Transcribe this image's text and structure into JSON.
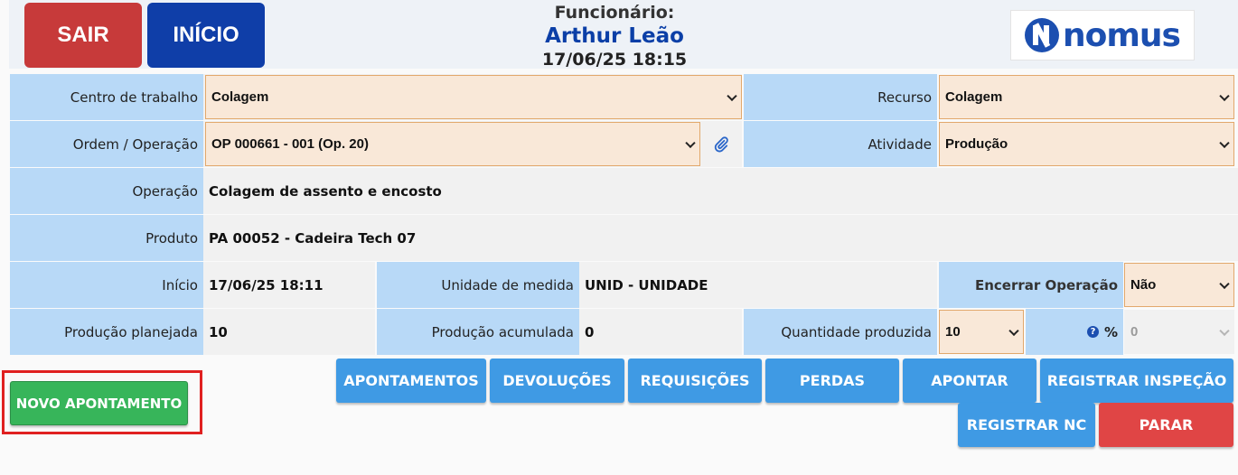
{
  "header": {
    "sair_label": "SAIR",
    "inicio_label": "INÍCIO",
    "employee_label": "Funcionário:",
    "employee_name": "Arthur Leão",
    "datetime": "17/06/25 18:15",
    "logo_text": "nomus"
  },
  "form": {
    "centro_label": "Centro de trabalho",
    "centro_value": "Colagem",
    "recurso_label": "Recurso",
    "recurso_value": "Colagem",
    "ordem_label": "Ordem / Operação",
    "ordem_value": "OP 000661 - 001 (Op. 20)",
    "atividade_label": "Atividade",
    "atividade_value": "Produção",
    "operacao_label": "Operação",
    "operacao_value": "Colagem de assento e encosto",
    "produto_label": "Produto",
    "produto_value": "PA 00052 - Cadeira Tech 07",
    "inicio_label": "Início",
    "inicio_value": "17/06/25 18:11",
    "unidade_label": "Unidade de medida",
    "unidade_value": "UNID - UNIDADE",
    "encerrar_label": "Encerrar Operação",
    "encerrar_value": "Não",
    "planejada_label": "Produção planejada",
    "planejada_value": "10",
    "acumulada_label": "Produção acumulada",
    "acumulada_value": "0",
    "qtd_label": "Quantidade produzida",
    "qtd_value": "10",
    "percent_label": "%",
    "percent_value": "0"
  },
  "actions": {
    "apontamentos": "APONTAMENTOS",
    "devolucoes": "DEVOLUÇÕES",
    "requisicoes": "REQUISIÇÕES",
    "perdas": "PERDAS",
    "apontar": "APONTAR",
    "registrar_inspecao": "REGISTRAR INSPEÇÃO",
    "registrar_nc": "REGISTRAR NC",
    "parar": "PARAR",
    "novo_apontamento": "NOVO APONTAMENTO"
  },
  "colors": {
    "label_bg": "#b8d9f7",
    "select_bg": "#f9e8d8",
    "action_blue": "#3f9ae4",
    "danger_red": "#e04545",
    "success_green": "#37b55a",
    "brand_blue": "#0b3fa7"
  }
}
